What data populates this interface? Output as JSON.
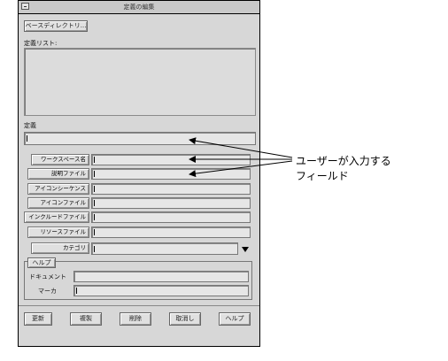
{
  "window": {
    "title": "定義の編集",
    "base_directory_button": "ベースディレクトリ...",
    "definition_list_label": "定義リスト:",
    "definition_label": "定義",
    "definition_value": "",
    "fields": [
      {
        "label": "ワークスペース名",
        "value": ""
      },
      {
        "label": "説明ファイル",
        "value": ""
      },
      {
        "label": "アイコンシーケンス",
        "value": ""
      },
      {
        "label": "アイコンファイル",
        "value": ""
      },
      {
        "label": "インクルードファイル",
        "value": ""
      },
      {
        "label": "リソースファイル",
        "value": ""
      },
      {
        "label": "カテゴリ",
        "value": ""
      }
    ],
    "help_group_label": "ヘルプ",
    "help_fields": [
      {
        "label": "ドキュメント",
        "value": ""
      },
      {
        "label": "マーカ",
        "value": ""
      }
    ],
    "buttons": [
      "更新",
      "複製",
      "削除",
      "取消し",
      "ヘルプ"
    ]
  },
  "callout": {
    "line1": "ユーザーが入力する",
    "line2": "フィールド"
  }
}
